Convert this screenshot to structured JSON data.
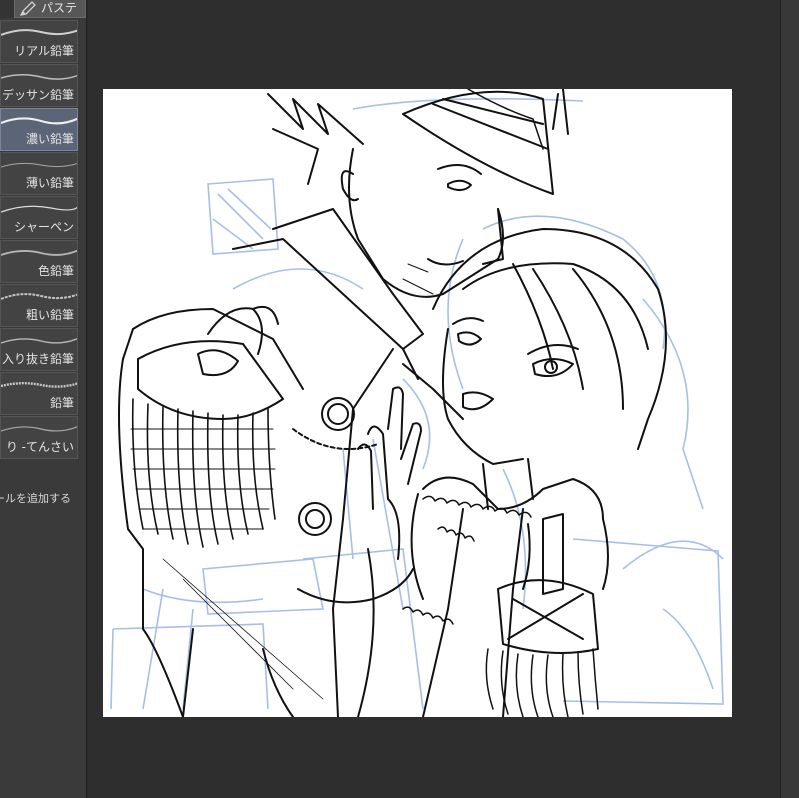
{
  "toolbar": {
    "active_tab_label": "パステ"
  },
  "brushes": [
    {
      "label": "リアル鉛筆",
      "selected": false
    },
    {
      "label": "デッサン鉛筆",
      "selected": false
    },
    {
      "label": "濃い鉛筆",
      "selected": true
    },
    {
      "label": "薄い鉛筆",
      "selected": false
    },
    {
      "label": "シャーペン",
      "selected": false
    },
    {
      "label": "色鉛筆",
      "selected": false
    },
    {
      "label": "粗い鉛筆",
      "selected": false
    },
    {
      "label": "入り抜き鉛筆",
      "selected": false
    },
    {
      "label": "鉛筆",
      "selected": false
    },
    {
      "label": "り -てんさい",
      "selected": false
    }
  ],
  "add_tool_label": "ールを追加する",
  "colors": {
    "panel": "#3a3a3a",
    "selected": "#5c6478",
    "workspace": "#2e2e2e",
    "canvas": "#ffffff",
    "sketch_blue": "#9fb9e6",
    "line_black": "#111111"
  }
}
